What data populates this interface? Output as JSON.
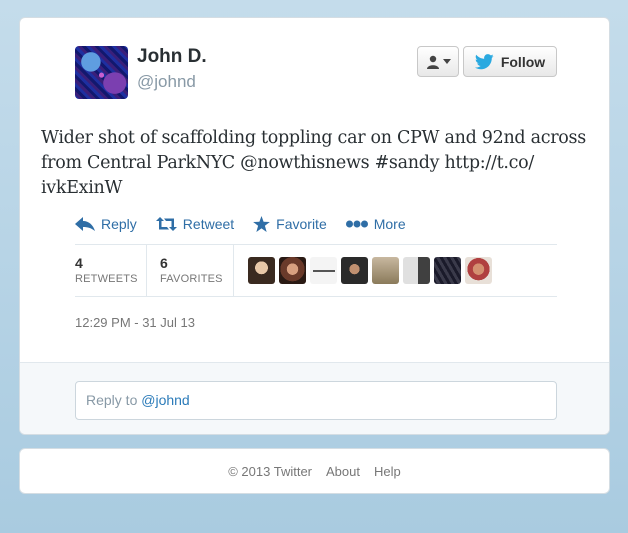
{
  "user": {
    "name": "John D.",
    "handle": "@johnd"
  },
  "follow_label": "Follow",
  "tweet": {
    "text_line1": "Wider shot of scaffolding toppling car on CPW and 92nd across",
    "text_line2": "from Central ParkNYC @nowthisnews #sandy http://t.co/",
    "text_line3": "ivkExinW"
  },
  "actions": [
    {
      "label": "Reply",
      "icon": "reply-icon"
    },
    {
      "label": "Retweet",
      "icon": "retweet-icon"
    },
    {
      "label": "Favorite",
      "icon": "star-icon"
    },
    {
      "label": "More",
      "icon": "more-dots-icon"
    }
  ],
  "stats": {
    "retweets_count": "4",
    "retweets_label": "RETWEETS",
    "favorites_count": "6",
    "favorites_label": "FAVORITES"
  },
  "timestamp": "12:29 PM - 31 Jul 13",
  "reply": {
    "prefix": "Reply to ",
    "mention": "@johnd"
  },
  "footer": {
    "copyright": "© 2013 Twitter",
    "about": "About",
    "help": "Help"
  },
  "colors": {
    "link_blue": "#2f6ea6",
    "twitter_bird": "#2aa9e0",
    "text_dark": "#292f33",
    "muted": "#8899a6"
  }
}
